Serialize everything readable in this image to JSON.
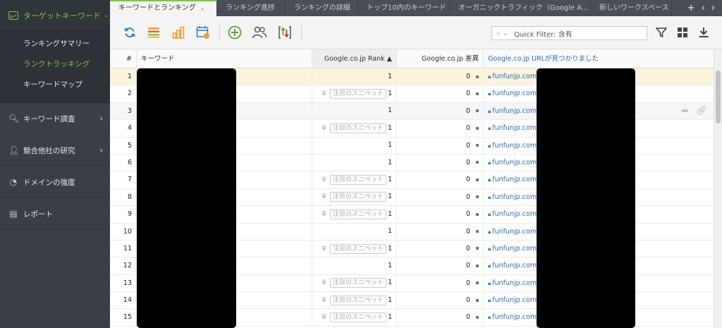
{
  "sidebar": {
    "head": "ターゲットキーワード",
    "sub_items": [
      "ランキングサマリー",
      "ランクトラッキング",
      "キーワードマップ"
    ],
    "items": [
      {
        "label": "キーワード調査",
        "icon": "search-icon"
      },
      {
        "label": "競合他社の研究",
        "icon": "user-icon"
      },
      {
        "label": "ドメインの強度",
        "icon": "gauge-icon"
      },
      {
        "label": "レポート",
        "icon": "report-icon"
      }
    ]
  },
  "tabs": [
    "キーワードとランキング",
    "ランキング進捗",
    "ランキングの詳細",
    "トップ10内のキーワード",
    "オーガニックトラフィック（Google A...",
    "新しいワークスペース"
  ],
  "quick_filter": {
    "label": "Quick Filter: 含有"
  },
  "columns": {
    "num": "#",
    "keyword": "キーワード",
    "rank": "Google.co.jp Rank ▲",
    "diff": "Google.co.jp 差異",
    "url": "Google.co.jp URLが見つかりました"
  },
  "snippet_label": "注目のスニペット",
  "rows": [
    {
      "num": "1",
      "rank": "1",
      "diff": "0",
      "url": "funfunjp.com/",
      "snippet": false
    },
    {
      "num": "2",
      "rank": "1",
      "diff": "0",
      "url": "funfunjp.com/",
      "snippet": true
    },
    {
      "num": "3",
      "rank": "1",
      "diff": "0",
      "url": "funfunjp.com/",
      "snippet": false
    },
    {
      "num": "4",
      "rank": "1",
      "diff": "0",
      "url": "funfunjp.com/",
      "snippet": true
    },
    {
      "num": "5",
      "rank": "1",
      "diff": "0",
      "url": "funfunjp.com/",
      "snippet": false
    },
    {
      "num": "6",
      "rank": "1",
      "diff": "0",
      "url": "funfunjp.com/",
      "snippet": false
    },
    {
      "num": "7",
      "rank": "1",
      "diff": "0",
      "url": "funfunjp.com/",
      "snippet": true
    },
    {
      "num": "8",
      "rank": "1",
      "diff": "0",
      "url": "funfunjp.com/",
      "snippet": true
    },
    {
      "num": "9",
      "rank": "1",
      "diff": "0",
      "url": "funfunjp.com/",
      "snippet": true
    },
    {
      "num": "10",
      "rank": "1",
      "diff": "0",
      "url": "funfunjp.com/",
      "snippet": false
    },
    {
      "num": "11",
      "rank": "1",
      "diff": "0",
      "url": "funfunjp.com/",
      "snippet": true
    },
    {
      "num": "12",
      "rank": "1",
      "diff": "0",
      "url": "funfunjp.com/",
      "snippet": false
    },
    {
      "num": "13",
      "rank": "1",
      "diff": "0",
      "url": "funfunjp.com/",
      "snippet": true
    },
    {
      "num": "14",
      "rank": "1",
      "diff": "0",
      "url": "funfunjp.com/",
      "snippet": true
    },
    {
      "num": "15",
      "rank": "1",
      "diff": "0",
      "url": "funfunjp.com/",
      "snippet": true
    }
  ],
  "colors": {
    "accent": "#7ec544",
    "sidebar": "#3a3f47",
    "selected_row": "#fbf3dc",
    "link": "#2a6db5"
  }
}
